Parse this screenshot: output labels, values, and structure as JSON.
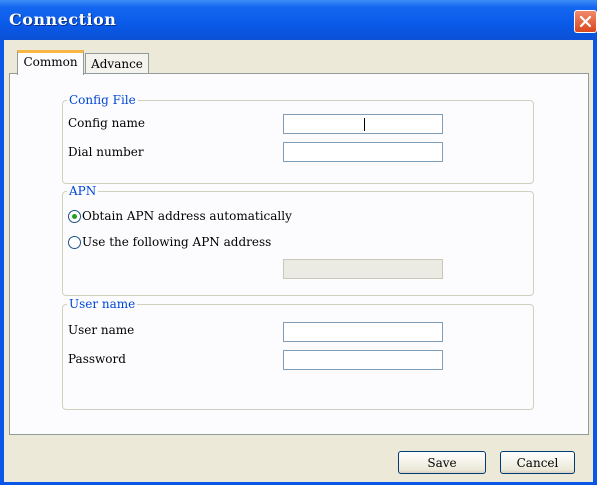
{
  "window": {
    "title": "Connection"
  },
  "tabs": [
    {
      "label": "Common",
      "active": true
    },
    {
      "label": "Advance",
      "active": false
    }
  ],
  "config_file": {
    "legend": "Config File",
    "config_name_label": "Config name",
    "config_name_value": "",
    "dial_number_label": "Dial number",
    "dial_number_value": ""
  },
  "apn": {
    "legend": "APN",
    "option_auto": "Obtain APN address automatically",
    "option_manual": "Use the following APN address",
    "selected": "auto",
    "address_value": ""
  },
  "user": {
    "legend": "User name",
    "username_label": "User name",
    "username_value": "",
    "password_label": "Password",
    "password_value": ""
  },
  "buttons": {
    "save": "Save",
    "cancel": "Cancel"
  },
  "colors": {
    "titlebar": "#0a5ae9",
    "legend_text": "#0046d5",
    "radio_dot": "#21a121",
    "tab_highlight": "#f7b545"
  },
  "icons": {
    "close": "close-icon"
  }
}
